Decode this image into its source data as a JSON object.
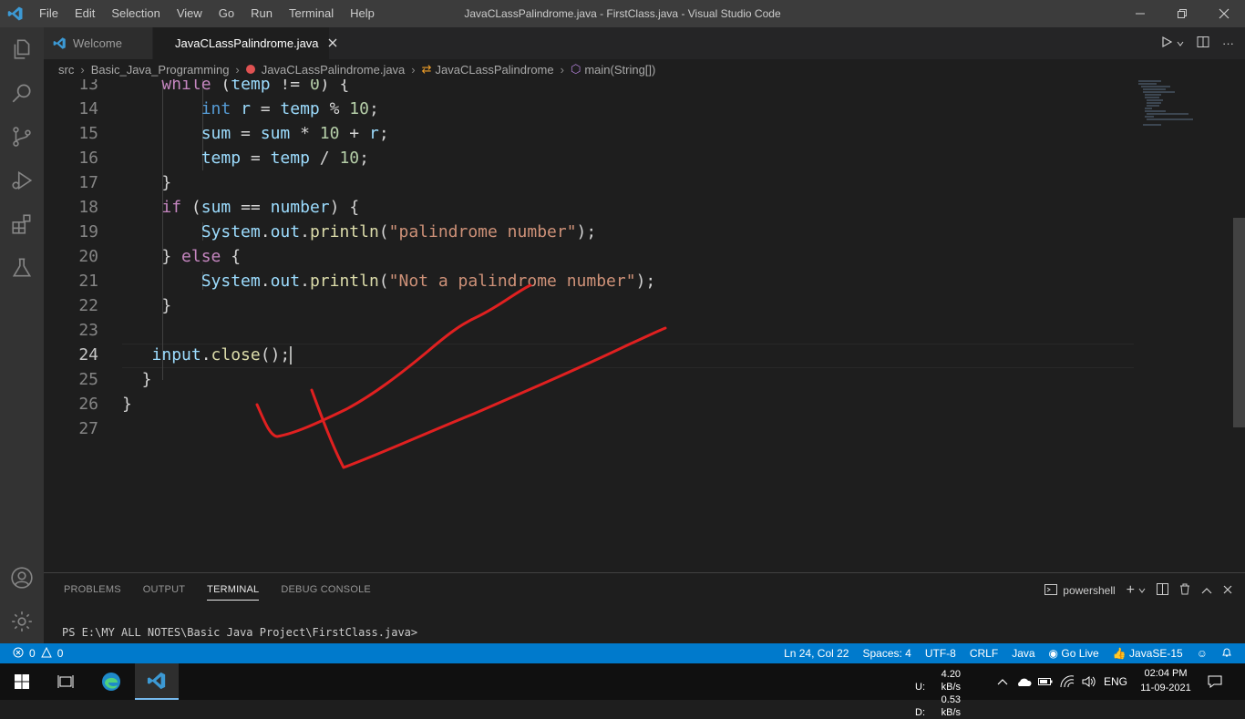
{
  "titlebar": {
    "menu": [
      "File",
      "Edit",
      "Selection",
      "View",
      "Go",
      "Run",
      "Terminal",
      "Help"
    ],
    "window_title": "JavaCLassPalindrome.java - FirstClass.java - Visual Studio Code"
  },
  "tabs": [
    {
      "label": "Welcome",
      "icon": "vscode-icon",
      "active": false
    },
    {
      "label": "JavaCLassPalindrome.java",
      "icon": "java-error-icon",
      "active": true
    }
  ],
  "breadcrumb": {
    "items": [
      "src",
      "Basic_Java_Programming",
      "JavaCLassPalindrome.java",
      "JavaCLassPalindrome",
      "main(String[])"
    ]
  },
  "editor": {
    "line_numbers": [
      "13",
      "14",
      "15",
      "16",
      "17",
      "18",
      "19",
      "20",
      "21",
      "22",
      "23",
      "24",
      "25",
      "26",
      "27"
    ],
    "current_line": "24"
  },
  "panel": {
    "tabs": [
      "PROBLEMS",
      "OUTPUT",
      "TERMINAL",
      "DEBUG CONSOLE"
    ],
    "active_tab": "TERMINAL",
    "shell": "powershell",
    "terminal_prompt": "PS E:\\MY ALL NOTES\\Basic Java Project\\FirstClass.java>"
  },
  "statusbar": {
    "errors": "0",
    "warnings": "0",
    "position": "Ln 24, Col 22",
    "spaces": "Spaces: 4",
    "encoding": "UTF-8",
    "eol": "CRLF",
    "language": "Java",
    "golive": "Go Live",
    "jdk": "JavaSE-15"
  },
  "taskbar": {
    "net_up_label": "U:",
    "net_up": "4.20 kB/s",
    "net_down_label": "D:",
    "net_down": "0.53 kB/s",
    "lang": "ENG",
    "time": "02:04 PM",
    "date": "11-09-2021"
  },
  "colors": {
    "accent": "#007acc",
    "annotation": "#e02020"
  }
}
